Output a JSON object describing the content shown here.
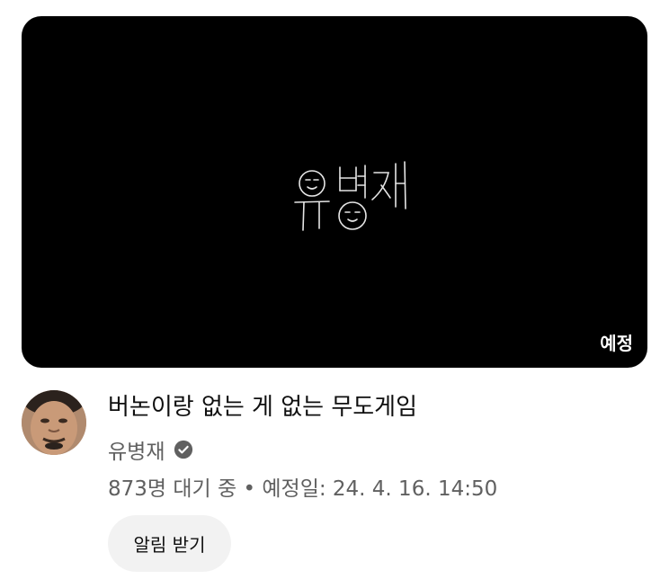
{
  "video": {
    "badge": "예정",
    "title": "버논이랑 없는 게 없는 무도게임",
    "thumbnail_text": "유병재"
  },
  "channel": {
    "name": "유병재",
    "verified_icon": "verified-check-icon"
  },
  "stats": {
    "waiting": "873명 대기 중",
    "separator": "•",
    "scheduled": "예정일: 24. 4. 16. 14:50"
  },
  "actions": {
    "notify_label": "알림 받기"
  },
  "colors": {
    "thumbnail_bg": "#000000",
    "title": "#0f0f0f",
    "secondary_text": "#606060",
    "button_bg": "#f2f2f2"
  }
}
